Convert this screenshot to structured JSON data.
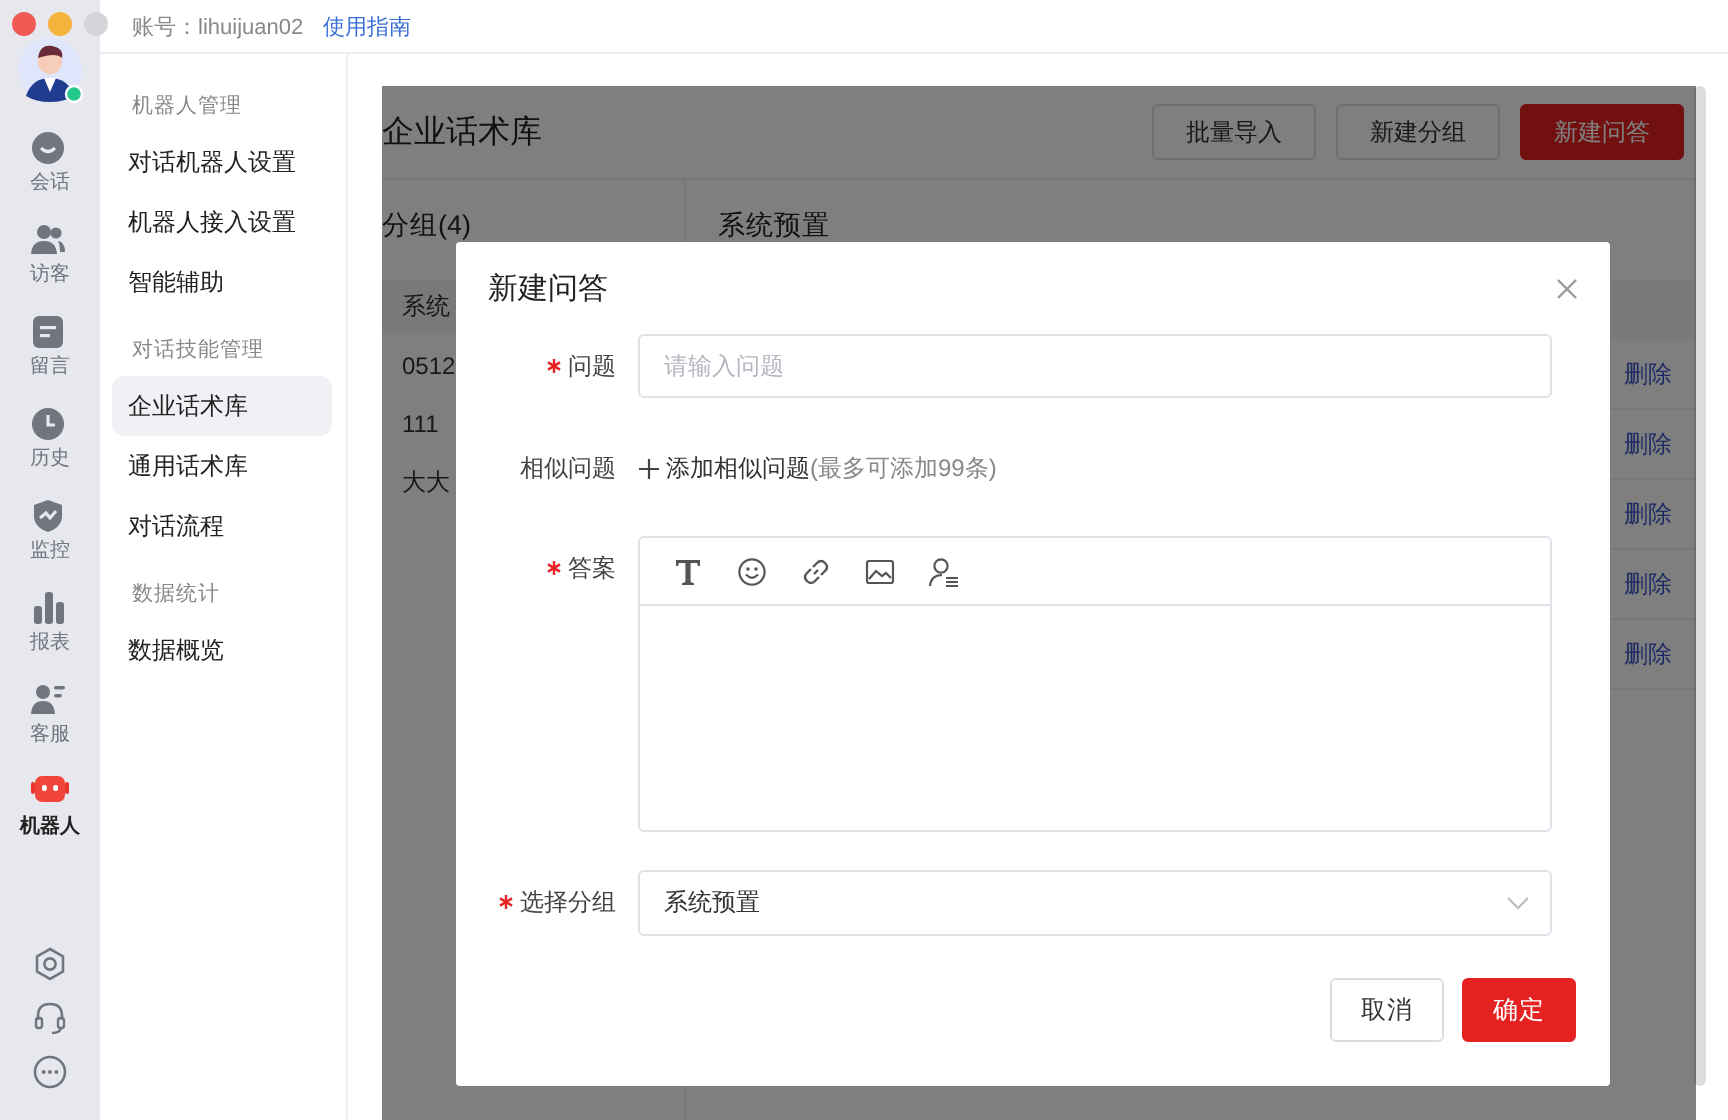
{
  "window": {
    "account": "账号：lihuijuan02",
    "guide_link": "使用指南"
  },
  "rail": {
    "items": [
      {
        "label": "会话",
        "selected": false
      },
      {
        "label": "访客",
        "selected": false
      },
      {
        "label": "留言",
        "selected": false
      },
      {
        "label": "历史",
        "selected": false
      },
      {
        "label": "监控",
        "selected": false
      },
      {
        "label": "报表",
        "selected": false
      },
      {
        "label": "客服",
        "selected": false
      },
      {
        "label": "机器人",
        "selected": true
      }
    ]
  },
  "menu": {
    "sections": [
      {
        "title": "机器人管理",
        "items": [
          {
            "label": "对话机器人设置",
            "selected": false
          },
          {
            "label": "机器人接入设置",
            "selected": false
          },
          {
            "label": "智能辅助",
            "selected": false
          }
        ]
      },
      {
        "title": "对话技能管理",
        "items": [
          {
            "label": "企业话术库",
            "selected": true
          },
          {
            "label": "通用话术库",
            "selected": false
          },
          {
            "label": "对话流程",
            "selected": false
          }
        ]
      },
      {
        "title": "数据统计",
        "items": [
          {
            "label": "数据概览",
            "selected": false
          }
        ]
      }
    ]
  },
  "page": {
    "title": "企业话术库",
    "buttons": [
      {
        "label": "批量导入",
        "kind": "default"
      },
      {
        "label": "新建分组",
        "kind": "default"
      },
      {
        "label": "新建问答",
        "kind": "primary"
      }
    ],
    "groups_header": "分组(4)",
    "groups": [
      {
        "label": "系统",
        "selected": true
      },
      {
        "label": "0512",
        "selected": false
      },
      {
        "label": "111",
        "selected": false
      },
      {
        "label": "大大",
        "selected": false
      }
    ],
    "list_title": "系统预置",
    "row_actions": [
      "删除",
      "删除",
      "删除",
      "删除",
      "删除"
    ]
  },
  "dialog": {
    "title": "新建问答",
    "question": {
      "label": "问题",
      "required": true,
      "placeholder": "请输入问题"
    },
    "similar": {
      "label": "相似问题",
      "add_link": "添加相似问题",
      "hint": "(最多可添加99条)"
    },
    "answer": {
      "label": "答案",
      "required": true
    },
    "group": {
      "label": "选择分组",
      "required": true,
      "value": "系统预置"
    },
    "buttons": [
      {
        "label": "取消",
        "kind": "default"
      },
      {
        "label": "确定",
        "kind": "primary"
      }
    ]
  }
}
